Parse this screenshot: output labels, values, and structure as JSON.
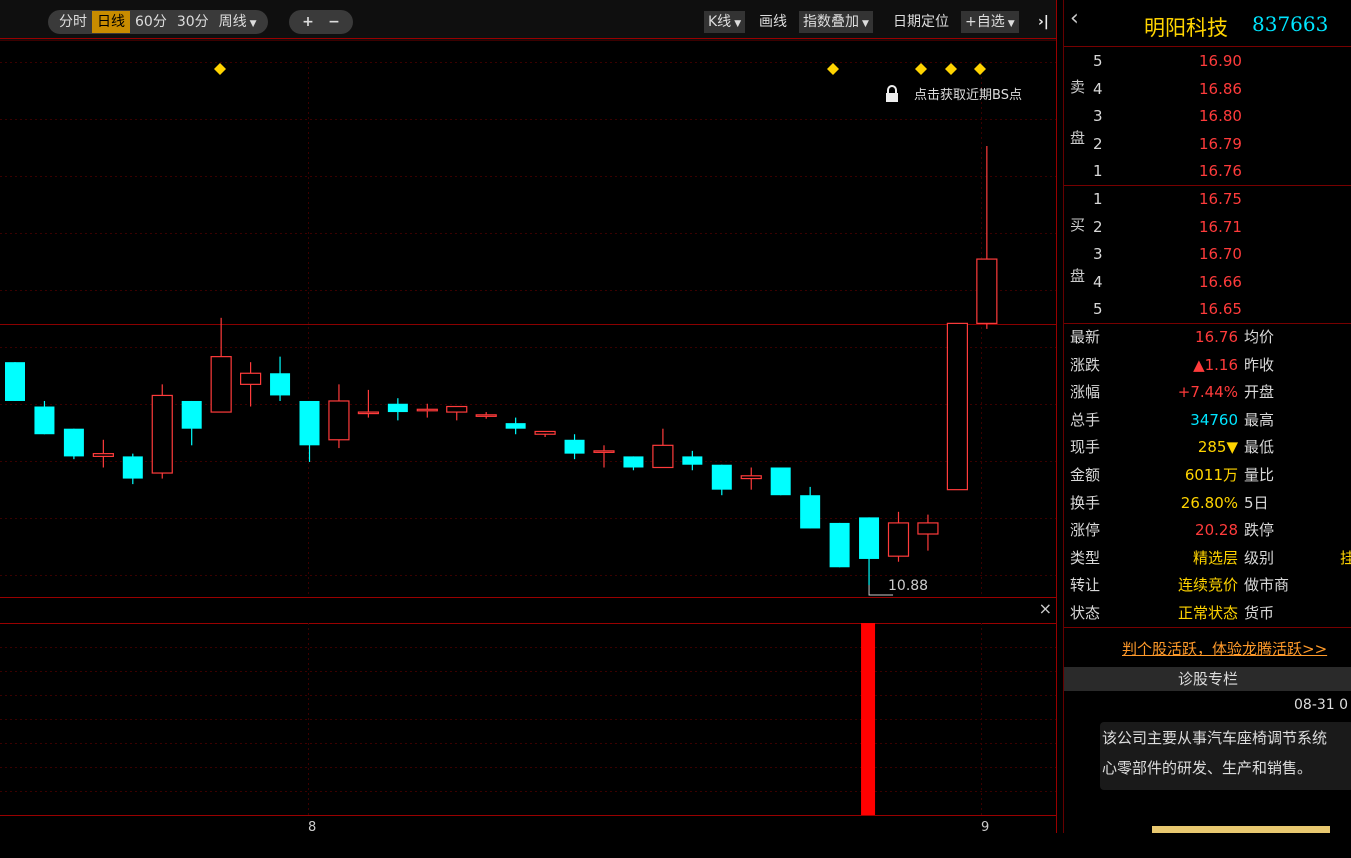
{
  "toolbar": {
    "periods": [
      "分时",
      "日线",
      "60分",
      "30分",
      "周线"
    ],
    "active_period": "日线",
    "zoom_in": "+",
    "zoom_out": "−",
    "kline_menu": "K线",
    "draw": "画线",
    "index_overlay": "指数叠加",
    "date_locate": "日期定位",
    "add_watch": "+自选",
    "collapse_icon": "›|"
  },
  "chart": {
    "bs_hint": "点击获取近期BS点",
    "low_label": "10.88",
    "x_ticks": [
      "8",
      "9"
    ],
    "colors": {
      "up": "#ff3b3b",
      "down": "#00ffff",
      "grid": "#3a0000",
      "marker": "#ffd400"
    },
    "candles": [
      {
        "o": 14.9,
        "c": 14.2,
        "h": 14.9,
        "l": 14.2
      },
      {
        "o": 14.1,
        "c": 13.6,
        "h": 14.2,
        "l": 13.6
      },
      {
        "o": 13.7,
        "c": 13.2,
        "h": 13.7,
        "l": 13.15
      },
      {
        "o": 13.2,
        "c": 13.25,
        "h": 13.5,
        "l": 13.0
      },
      {
        "o": 13.2,
        "c": 12.8,
        "h": 13.25,
        "l": 12.7
      },
      {
        "o": 12.9,
        "c": 14.3,
        "h": 14.5,
        "l": 12.8
      },
      {
        "o": 14.2,
        "c": 13.7,
        "h": 14.2,
        "l": 13.4
      },
      {
        "o": 14.0,
        "c": 15.0,
        "h": 15.7,
        "l": 14.0
      },
      {
        "o": 14.5,
        "c": 14.7,
        "h": 14.9,
        "l": 14.1
      },
      {
        "o": 14.7,
        "c": 14.3,
        "h": 15.0,
        "l": 14.2
      },
      {
        "o": 14.2,
        "c": 13.4,
        "h": 14.2,
        "l": 13.1
      },
      {
        "o": 13.5,
        "c": 14.2,
        "h": 14.5,
        "l": 13.35
      },
      {
        "o": 14.0,
        "c": 14.0,
        "h": 14.4,
        "l": 13.9
      },
      {
        "o": 14.15,
        "c": 14.0,
        "h": 14.25,
        "l": 13.85
      },
      {
        "o": 14.05,
        "c": 14.05,
        "h": 14.15,
        "l": 13.9
      },
      {
        "o": 14.0,
        "c": 14.1,
        "h": 14.1,
        "l": 13.85
      },
      {
        "o": 13.95,
        "c": 13.95,
        "h": 14.0,
        "l": 13.88
      },
      {
        "o": 13.8,
        "c": 13.7,
        "h": 13.9,
        "l": 13.6
      },
      {
        "o": 13.6,
        "c": 13.65,
        "h": 13.65,
        "l": 13.55
      },
      {
        "o": 13.5,
        "c": 13.25,
        "h": 13.6,
        "l": 13.15
      },
      {
        "o": 13.3,
        "c": 13.3,
        "h": 13.4,
        "l": 13.0
      },
      {
        "o": 13.2,
        "c": 13.0,
        "h": 13.2,
        "l": 12.95
      },
      {
        "o": 13.0,
        "c": 13.4,
        "h": 13.7,
        "l": 13.0
      },
      {
        "o": 13.2,
        "c": 13.05,
        "h": 13.3,
        "l": 12.95
      },
      {
        "o": 13.05,
        "c": 12.6,
        "h": 13.05,
        "l": 12.5
      },
      {
        "o": 12.8,
        "c": 12.85,
        "h": 13.0,
        "l": 12.6
      },
      {
        "o": 13.0,
        "c": 12.5,
        "h": 13.0,
        "l": 12.5
      },
      {
        "o": 12.5,
        "c": 11.9,
        "h": 12.65,
        "l": 11.9
      },
      {
        "o": 12.0,
        "c": 11.2,
        "h": 12.0,
        "l": 11.2
      },
      {
        "o": 12.1,
        "c": 11.35,
        "h": 12.1,
        "l": 10.88
      },
      {
        "o": 11.4,
        "c": 12.0,
        "h": 12.2,
        "l": 11.3
      },
      {
        "o": 11.8,
        "c": 12.0,
        "h": 12.15,
        "l": 11.5
      },
      {
        "o": 12.6,
        "c": 15.6,
        "h": 15.6,
        "l": 12.6
      },
      {
        "o": 15.6,
        "c": 16.76,
        "h": 18.8,
        "l": 15.5
      }
    ],
    "markers_at": [
      7,
      28,
      31,
      32,
      33
    ],
    "volumes": [
      0,
      0,
      0,
      0,
      0,
      0,
      0,
      0,
      0,
      0,
      0,
      0,
      0,
      0,
      0,
      0,
      0,
      0,
      0,
      0,
      0,
      0,
      0,
      0,
      0,
      0,
      0,
      0,
      0,
      34760,
      0,
      0,
      0,
      0
    ]
  },
  "panel": {
    "back_icon": "‹",
    "name": "明阳科技",
    "code": "837663",
    "sell_label_1": "卖",
    "sell_label_2": "盘",
    "buy_label_1": "买",
    "buy_label_2": "盘",
    "sell": [
      {
        "lvl": "5",
        "price": "16.90"
      },
      {
        "lvl": "4",
        "price": "16.86"
      },
      {
        "lvl": "3",
        "price": "16.80"
      },
      {
        "lvl": "2",
        "price": "16.79"
      },
      {
        "lvl": "1",
        "price": "16.76"
      }
    ],
    "buy": [
      {
        "lvl": "1",
        "price": "16.75"
      },
      {
        "lvl": "2",
        "price": "16.71"
      },
      {
        "lvl": "3",
        "price": "16.70"
      },
      {
        "lvl": "4",
        "price": "16.66"
      },
      {
        "lvl": "5",
        "price": "16.65"
      }
    ],
    "stats": [
      {
        "label": "最新",
        "value": "16.76",
        "color": "red",
        "label2": "均价"
      },
      {
        "label": "涨跌",
        "value": "▲1.16",
        "color": "red",
        "label2": "昨收"
      },
      {
        "label": "涨幅",
        "value": "+7.44%",
        "color": "red",
        "label2": "开盘"
      },
      {
        "label": "总手",
        "value": "34760",
        "color": "cyan",
        "label2": "最高"
      },
      {
        "label": "现手",
        "value": "285▼",
        "color": "yellow",
        "label2": "最低"
      },
      {
        "label": "金额",
        "value": "6011万",
        "color": "yellow",
        "label2": "量比"
      },
      {
        "label": "换手",
        "value": "26.80%",
        "color": "yellow",
        "label2": "5日"
      },
      {
        "label": "涨停",
        "value": "20.28",
        "color": "red",
        "label2": "跌停"
      },
      {
        "label": "类型",
        "value": "精选层",
        "color": "yellow",
        "label2": "级别",
        "extra": "挂"
      },
      {
        "label": "转让",
        "value": "连续竞价",
        "color": "yellow",
        "label2": "做市商"
      },
      {
        "label": "状态",
        "value": "正常状态",
        "color": "yellow",
        "label2": "货币"
      }
    ],
    "promo_link": "判个股活跃，体验龙腾活跃>>",
    "diag_header": "诊股专栏",
    "diag_date": "08-31 0",
    "diag_text_1": "该公司主要从事汽车座椅调节系统",
    "diag_text_2": "心零部件的研发、生产和销售。",
    "close_icon": "×"
  }
}
